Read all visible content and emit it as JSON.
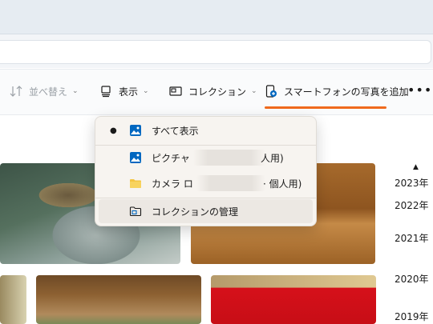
{
  "toolbar": {
    "sort_label": "並べ替え",
    "view_label": "表示",
    "collection_label": "コレクション",
    "phone_label": "スマートフォンの写真を追加",
    "more_label": "•••"
  },
  "menu": {
    "items": [
      {
        "label": "すべて表示",
        "selected": true,
        "icon": "image-icon"
      },
      {
        "label": "ピクチャ (",
        "suffix": "人用)",
        "icon": "image-icon"
      },
      {
        "label": "カメラ ロ",
        "suffix": "· 個人用)",
        "icon": "folder-icon"
      },
      {
        "label": "コレクションの管理",
        "icon": "manage-folder-icon"
      }
    ]
  },
  "timeline": {
    "years": [
      "2023年",
      "2022年",
      "2021年",
      "2020年",
      "2019年"
    ]
  },
  "colors": {
    "accent": "#f06a1d",
    "brand_blue": "#0067c0"
  }
}
